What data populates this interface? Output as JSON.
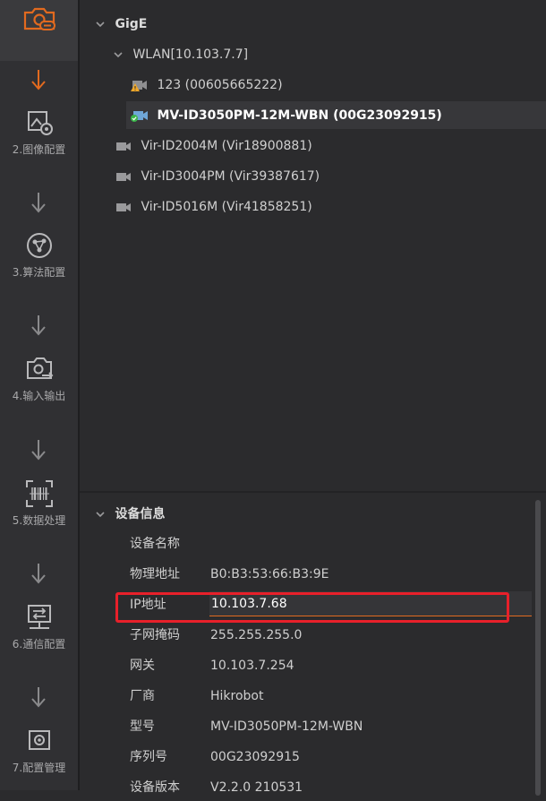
{
  "sidebar": {
    "steps": [
      {
        "label": "2.图像配置",
        "icon": "image-settings-icon"
      },
      {
        "label": "3.算法配置",
        "icon": "algorithm-icon"
      },
      {
        "label": "4.输入输出",
        "icon": "camera-io-icon"
      },
      {
        "label": "5.数据处理",
        "icon": "barcode-scan-icon"
      },
      {
        "label": "6.通信配置",
        "icon": "communication-icon"
      },
      {
        "label": "7.配置管理",
        "icon": "config-manage-icon"
      }
    ],
    "top_icon": "camera-link-icon",
    "active_color": "#e26a1f"
  },
  "tree": {
    "group": "GigE",
    "adapter": "WLAN[10.103.7.7]",
    "devices": [
      {
        "label": "123 (00605665222)",
        "status": "warning"
      },
      {
        "label": "MV-ID3050PM-12M-WBN (00G23092915)",
        "status": "connected",
        "selected": true
      }
    ],
    "virtual_devices": [
      {
        "label": "Vir-ID2004M (Vir18900881)"
      },
      {
        "label": "Vir-ID3004PM (Vir39387617)"
      },
      {
        "label": "Vir-ID5016M (Vir41858251)"
      }
    ]
  },
  "info": {
    "title": "设备信息",
    "rows": [
      {
        "key": "设备名称",
        "value": ""
      },
      {
        "key": "物理地址",
        "value": "B0:B3:53:66:B3:9E"
      },
      {
        "key": "IP地址",
        "value": "10.103.7.68"
      },
      {
        "key": "子网掩码",
        "value": "255.255.255.0"
      },
      {
        "key": "网关",
        "value": "10.103.7.254"
      },
      {
        "key": "厂商",
        "value": "Hikrobot"
      },
      {
        "key": "型号",
        "value": "MV-ID3050PM-12M-WBN"
      },
      {
        "key": "序列号",
        "value": "00G23092915"
      },
      {
        "key": "设备版本",
        "value": "V2.2.0 210531"
      }
    ],
    "highlight_color": "#e8202a"
  }
}
